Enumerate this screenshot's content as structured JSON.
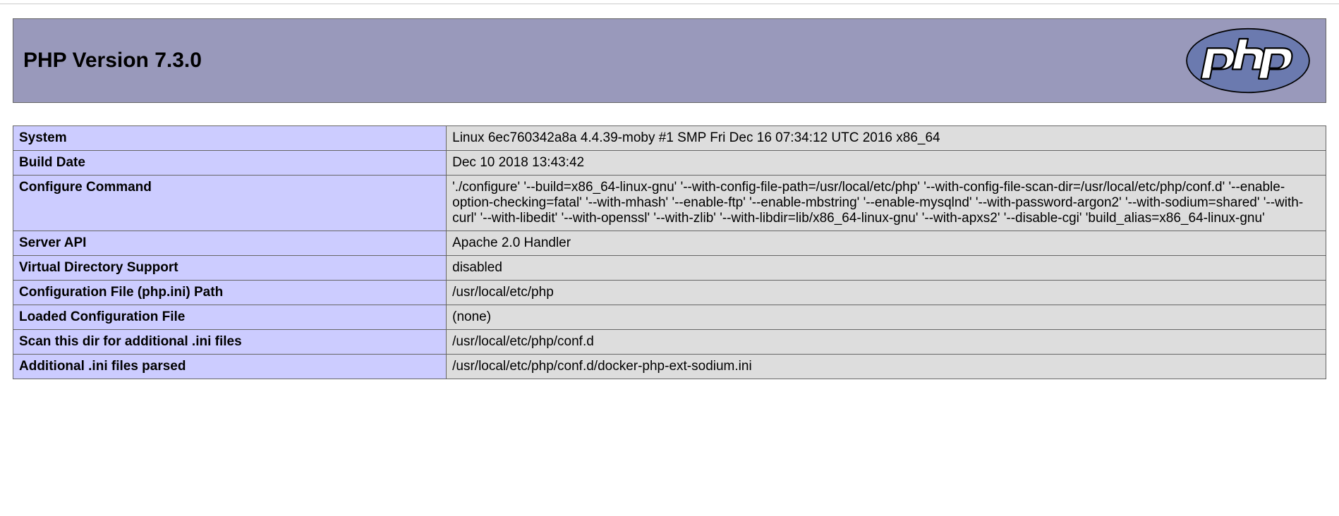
{
  "header": {
    "title": "PHP Version 7.3.0"
  },
  "info": [
    {
      "label": "System",
      "value": "Linux 6ec760342a8a 4.4.39-moby #1 SMP Fri Dec 16 07:34:12 UTC 2016 x86_64"
    },
    {
      "label": "Build Date",
      "value": "Dec 10 2018 13:43:42"
    },
    {
      "label": "Configure Command",
      "value": "'./configure' '--build=x86_64-linux-gnu' '--with-config-file-path=/usr/local/etc/php' '--with-config-file-scan-dir=/usr/local/etc/php/conf.d' '--enable-option-checking=fatal' '--with-mhash' '--enable-ftp' '--enable-mbstring' '--enable-mysqlnd' '--with-password-argon2' '--with-sodium=shared' '--with-curl' '--with-libedit' '--with-openssl' '--with-zlib' '--with-libdir=lib/x86_64-linux-gnu' '--with-apxs2' '--disable-cgi' 'build_alias=x86_64-linux-gnu'"
    },
    {
      "label": "Server API",
      "value": "Apache 2.0 Handler"
    },
    {
      "label": "Virtual Directory Support",
      "value": "disabled"
    },
    {
      "label": "Configuration File (php.ini) Path",
      "value": "/usr/local/etc/php"
    },
    {
      "label": "Loaded Configuration File",
      "value": "(none)"
    },
    {
      "label": "Scan this dir for additional .ini files",
      "value": "/usr/local/etc/php/conf.d"
    },
    {
      "label": "Additional .ini files parsed",
      "value": "/usr/local/etc/php/conf.d/docker-php-ext-sodium.ini"
    }
  ]
}
